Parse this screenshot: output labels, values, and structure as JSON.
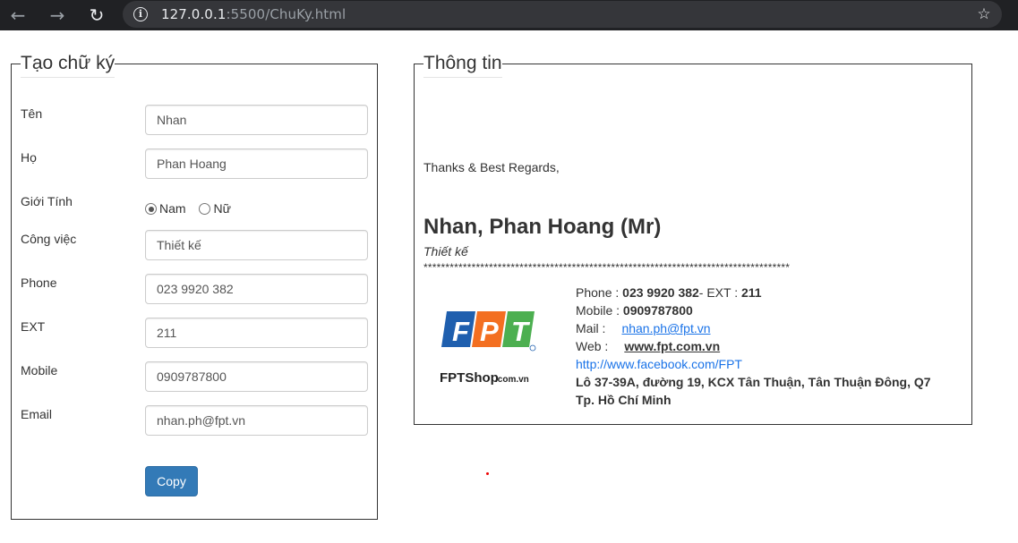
{
  "browser": {
    "url_host": "127.0.0.1",
    "url_rest": ":5500/ChuKy.html",
    "back_icon": "←",
    "forward_icon": "→",
    "reload_icon": "↻",
    "info_icon": "i",
    "star_icon": "☆"
  },
  "form": {
    "legend": "Tạo chữ ký",
    "fields": {
      "ten": {
        "label": "Tên",
        "value": "Nhan"
      },
      "ho": {
        "label": "Họ",
        "value": "Phan Hoang"
      },
      "gioitinh": {
        "label": "Giới Tính",
        "opt1": "Nam",
        "opt2": "Nữ"
      },
      "congviec": {
        "label": "Công việc",
        "value": "Thiết kế"
      },
      "phone": {
        "label": "Phone",
        "value": "023 9920 382"
      },
      "ext": {
        "label": "EXT",
        "value": "211"
      },
      "mobile": {
        "label": "Mobile",
        "value": "0909787800"
      },
      "email": {
        "label": "Email",
        "value": "nhan.ph@fpt.vn"
      }
    },
    "copy_label": "Copy"
  },
  "info": {
    "legend": "Thông tin",
    "regards": "Thanks & Best Regards,",
    "fullname": "Nhan, Phan Hoang (Mr)",
    "job": "Thiết kế",
    "stars": "************************************************************************************",
    "logo_letters": [
      "F",
      "P",
      "T"
    ],
    "logo_shop": "FPTShop",
    "logo_domain": ".com.vn",
    "phone_label": "Phone : ",
    "phone_value": "023 9920 382",
    "ext_label": "- EXT : ",
    "ext_value": "211",
    "mobile_label": "Mobile : ",
    "mobile_value": "0909787800",
    "mail_label": "Mail :",
    "mail_value": "nhan.ph@fpt.vn",
    "web_label": "Web :",
    "web_value": "www.fpt.com.vn",
    "facebook": "http://www.facebook.com/FPT",
    "address1": "Lô 37-39A, đường 19, KCX Tân Thuận, Tân Thuận Đông, Q7",
    "address2": "Tp. Hồ Chí Minh",
    "colors": {
      "fpt_blue": "#1f5fae",
      "fpt_orange": "#f36f21",
      "fpt_green": "#4caf50",
      "button": "#337ab7"
    }
  }
}
